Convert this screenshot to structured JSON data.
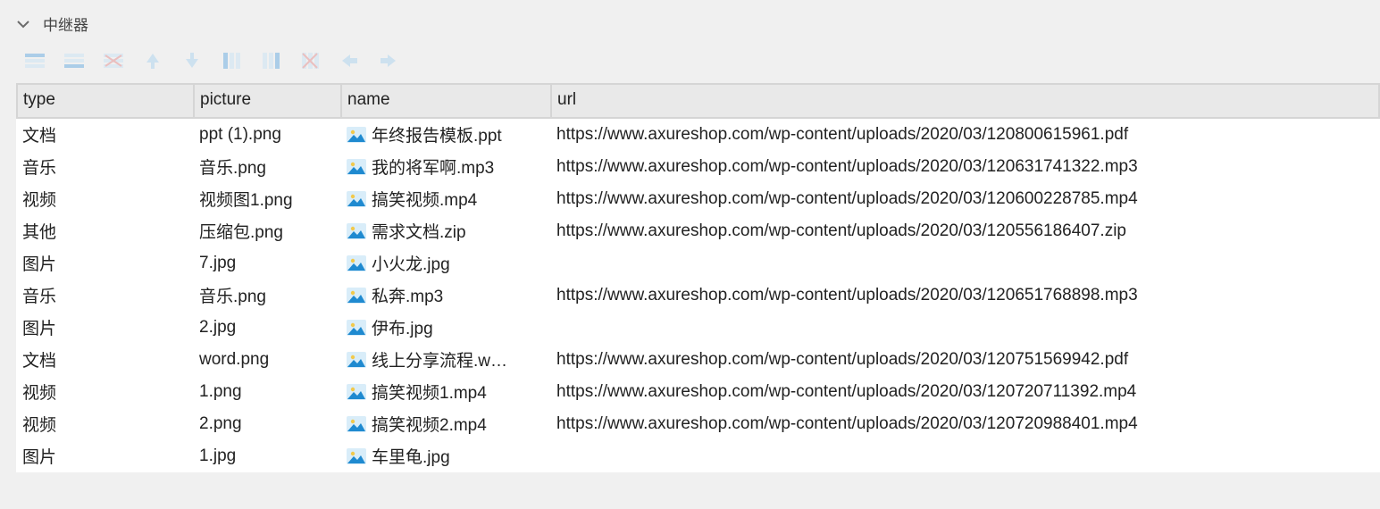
{
  "panel": {
    "title": "中继器"
  },
  "toolbar_icons": [
    "add-row-above-icon",
    "add-row-below-icon",
    "delete-row-icon",
    "move-up-icon",
    "move-down-icon",
    "add-col-left-icon",
    "add-col-right-icon",
    "delete-col-icon",
    "move-left-icon",
    "move-right-icon"
  ],
  "table": {
    "columns": [
      {
        "key": "type",
        "label": "type"
      },
      {
        "key": "picture",
        "label": "picture"
      },
      {
        "key": "name",
        "label": "name"
      },
      {
        "key": "url",
        "label": "url"
      }
    ],
    "rows": [
      {
        "type": "文档",
        "picture": "ppt (1).png",
        "name": "年终报告模板.ppt",
        "url": "https://www.axureshop.com/wp-content/uploads/2020/03/120800615961.pdf"
      },
      {
        "type": "音乐",
        "picture": "音乐.png",
        "name": "我的将军啊.mp3",
        "url": "https://www.axureshop.com/wp-content/uploads/2020/03/120631741322.mp3"
      },
      {
        "type": "视频",
        "picture": "视频图1.png",
        "name": "搞笑视频.mp4",
        "url": "https://www.axureshop.com/wp-content/uploads/2020/03/120600228785.mp4"
      },
      {
        "type": "其他",
        "picture": "压缩包.png",
        "name": "需求文档.zip",
        "url": "https://www.axureshop.com/wp-content/uploads/2020/03/120556186407.zip"
      },
      {
        "type": "图片",
        "picture": "7.jpg",
        "name": "小火龙.jpg",
        "url": ""
      },
      {
        "type": "音乐",
        "picture": "音乐.png",
        "name": "私奔.mp3",
        "url": "https://www.axureshop.com/wp-content/uploads/2020/03/120651768898.mp3"
      },
      {
        "type": "图片",
        "picture": "2.jpg",
        "name": "伊布.jpg",
        "url": ""
      },
      {
        "type": "文档",
        "picture": "word.png",
        "name": "线上分享流程.w…",
        "url": "https://www.axureshop.com/wp-content/uploads/2020/03/120751569942.pdf"
      },
      {
        "type": "视频",
        "picture": "1.png",
        "name": "搞笑视频1.mp4",
        "url": "https://www.axureshop.com/wp-content/uploads/2020/03/120720711392.mp4"
      },
      {
        "type": "视频",
        "picture": "2.png",
        "name": "搞笑视频2.mp4",
        "url": "https://www.axureshop.com/wp-content/uploads/2020/03/120720988401.mp4"
      },
      {
        "type": "图片",
        "picture": "1.jpg",
        "name": "车里龟.jpg",
        "url": ""
      }
    ]
  }
}
